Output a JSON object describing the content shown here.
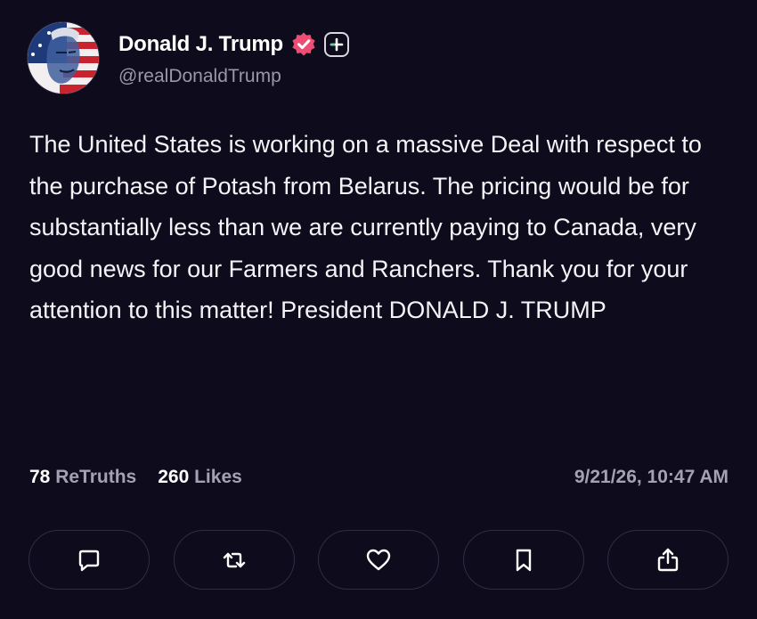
{
  "profile": {
    "display_name": "Donald J. Trump",
    "handle": "@realDonaldTrump",
    "verified_color": "#ef4e74",
    "avatar_icon": "flag-portrait-avatar"
  },
  "post": {
    "text": "The United States is working on a massive Deal with respect to the purchase of Potash from Belarus. The pricing would be for substantially less than we are currently paying to Canada, very good news for our Farmers and Ranchers. Thank you for your attention to this matter! President DONALD J. TRUMP"
  },
  "stats": {
    "retruths_count": "78",
    "retruths_label": "ReTruths",
    "likes_count": "260",
    "likes_label": "Likes"
  },
  "timestamp": "9/21/26, 10:47 AM",
  "actions": [
    {
      "name": "reply",
      "icon": "comment-icon"
    },
    {
      "name": "retruth",
      "icon": "retruth-icon"
    },
    {
      "name": "like",
      "icon": "heart-icon"
    },
    {
      "name": "bookmark",
      "icon": "bookmark-icon"
    },
    {
      "name": "share",
      "icon": "share-icon"
    }
  ]
}
